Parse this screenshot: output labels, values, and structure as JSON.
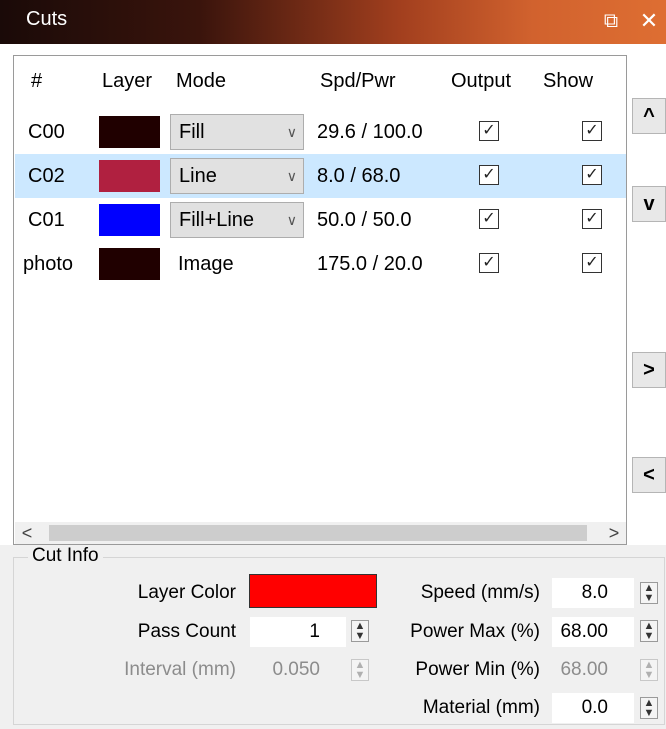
{
  "window": {
    "title": "Cuts",
    "float_icon": "⧉",
    "close_icon": "✕"
  },
  "table": {
    "columns": [
      "#",
      "Layer",
      "Mode",
      "Spd/Pwr",
      "Output",
      "Show"
    ],
    "rows": [
      {
        "id": "C00",
        "layer_color": "#200000",
        "mode": "Fill",
        "has_dropdown": true,
        "spd_pwr": "29.6 / 100.0",
        "output": true,
        "show": true,
        "selected": false
      },
      {
        "id": "C02",
        "layer_color": "#b02040",
        "mode": "Line",
        "has_dropdown": true,
        "spd_pwr": "8.0 / 68.0",
        "output": true,
        "show": true,
        "selected": true
      },
      {
        "id": "C01",
        "layer_color": "#0000ff",
        "mode": "Fill+Line",
        "has_dropdown": true,
        "spd_pwr": "50.0 / 50.0",
        "output": true,
        "show": true,
        "selected": false
      },
      {
        "id": "photo",
        "layer_color": "#200000",
        "mode": "Image",
        "has_dropdown": false,
        "spd_pwr": "175.0 / 20.0",
        "output": true,
        "show": true,
        "selected": false
      }
    ],
    "hscroll": {
      "left_icon": "<",
      "right_icon": ">"
    }
  },
  "side_buttons": {
    "up": "^",
    "down": "v",
    "right": ">",
    "left": "<"
  },
  "cut_info": {
    "title": "Cut Info",
    "layer_color_label": "Layer Color",
    "layer_color": "#ff0000",
    "pass_count_label": "Pass Count",
    "pass_count": "1",
    "interval_label": "Interval (mm)",
    "interval": "0.050",
    "speed_label": "Speed (mm/s)",
    "speed": "8.0",
    "power_max_label": "Power Max (%)",
    "power_max": "68.00",
    "power_min_label": "Power Min (%)",
    "power_min": "68.00",
    "material_label": "Material (mm)",
    "material": "0.0"
  },
  "colors": {
    "title_gradient_start": "#1a0a08",
    "title_gradient_end": "#de6e32",
    "selection": "#cce8ff"
  }
}
